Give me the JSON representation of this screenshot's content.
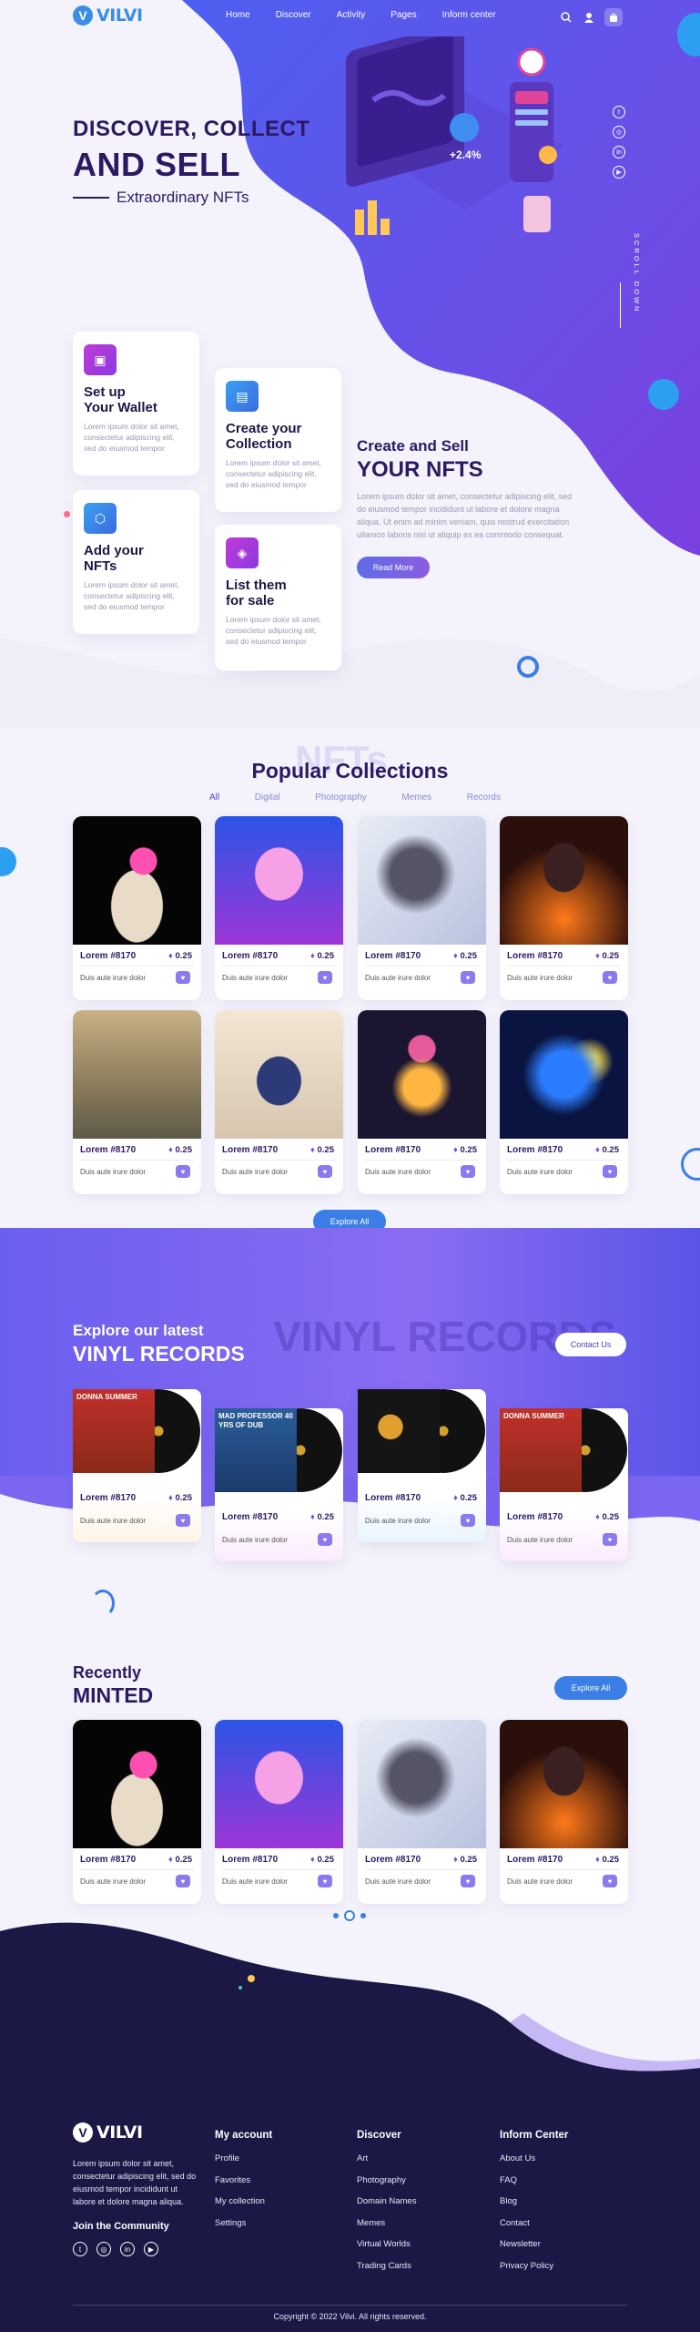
{
  "header": {
    "logo": "VILVI",
    "nav": [
      "Home",
      "Discover",
      "Activity",
      "Pages",
      "Inform center"
    ]
  },
  "hero": {
    "line1": "DISCOVER, COLLECT",
    "line2": "AND SELL",
    "line3": "Extraordinary NFTs",
    "scroll": "SCROLL DOWN",
    "stat": "+2.4%"
  },
  "steps": [
    {
      "title_a": "Set up",
      "title_b": "Your Wallet",
      "text": "Lorem ipsum dolor sit amet, consectetur adipiscing elit, sed do eiusmod tempor"
    },
    {
      "title_a": "Create your",
      "title_b": "Collection",
      "text": "Lorem ipsum dolor sit amet, consectetur adipiscing elit, sed do eiusmod tempor"
    },
    {
      "title_a": "Add your",
      "title_b": "NFTs",
      "text": "Lorem ipsum dolor sit amet, consectetur adipiscing elit, sed do eiusmod tempor"
    },
    {
      "title_a": "List them",
      "title_b": "for sale",
      "text": "Lorem ipsum dolor sit amet, consectetur adipiscing elit, sed do eiusmod tempor"
    }
  ],
  "sell": {
    "title_a": "Create and Sell",
    "title_b": "YOUR NFTS",
    "text": "Lorem ipsum dolor sit amet, consectetur adipiscing elit, sed do eiusmod tempor incididunt ut labore et dolore magna aliqua. Ut enim ad minim veniam, quis nostrud exercitation ullamco laboris nisi ut aliquip ex ea commodo consequat.",
    "button": "Read More"
  },
  "popular": {
    "ghost": "NFTs",
    "title": "Popular Collections",
    "filters": [
      "All",
      "Digital",
      "Photography",
      "Memes",
      "Records"
    ],
    "items": [
      {
        "name": "Lorem #8170",
        "price": "0.25",
        "desc": "Duis aute irure dolor"
      },
      {
        "name": "Lorem #8170",
        "price": "0.25",
        "desc": "Duis aute irure dolor"
      },
      {
        "name": "Lorem #8170",
        "price": "0.25",
        "desc": "Duis aute irure dolor"
      },
      {
        "name": "Lorem #8170",
        "price": "0.25",
        "desc": "Duis aute irure dolor"
      },
      {
        "name": "Lorem #8170",
        "price": "0.25",
        "desc": "Duis aute irure dolor"
      },
      {
        "name": "Lorem #8170",
        "price": "0.25",
        "desc": "Duis aute irure dolor"
      },
      {
        "name": "Lorem #8170",
        "price": "0.25",
        "desc": "Duis aute irure dolor"
      },
      {
        "name": "Lorem #8170",
        "price": "0.25",
        "desc": "Duis aute irure dolor"
      }
    ],
    "button": "Explore All"
  },
  "vinyl": {
    "ghost": "VINYL RECORDS",
    "title_a": "Explore our latest",
    "title_b": "VINYL RECORDS",
    "button": "Contact Us",
    "items": [
      {
        "name": "Lorem #8170",
        "price": "0.25",
        "desc": "Duis aute irure dolor",
        "cover": "DONNA SUMMER"
      },
      {
        "name": "Lorem #8170",
        "price": "0.25",
        "desc": "Duis aute irure dolor",
        "cover": "MAD PROFESSOR 40 YRS OF DUB"
      },
      {
        "name": "Lorem #8170",
        "price": "0.25",
        "desc": "Duis aute irure dolor",
        "cover": ""
      },
      {
        "name": "Lorem #8170",
        "price": "0.25",
        "desc": "Duis aute irure dolor",
        "cover": "DONNA SUMMER"
      }
    ]
  },
  "recent": {
    "title_a": "Recently",
    "title_b": "MINTED",
    "button": "Explore All",
    "items": [
      {
        "name": "Lorem #8170",
        "price": "0.25",
        "desc": "Duis aute irure dolor"
      },
      {
        "name": "Lorem #8170",
        "price": "0.25",
        "desc": "Duis aute irure dolor"
      },
      {
        "name": "Lorem #8170",
        "price": "0.25",
        "desc": "Duis aute irure dolor"
      },
      {
        "name": "Lorem #8170",
        "price": "0.25",
        "desc": "Duis aute irure dolor"
      }
    ]
  },
  "footer": {
    "logo": "VILVI",
    "about": "Lorem ipsum dolor sit amet, consectetur adipiscing elit, sed do eiusmod tempor incididunt ut labore et dolore magna aliqua.",
    "join": "Join the Community",
    "columns": [
      {
        "title": "My account",
        "links": [
          "Profile",
          "Favorites",
          "My collection",
          "Settings"
        ]
      },
      {
        "title": "Discover",
        "links": [
          "Art",
          "Photography",
          "Domain Names",
          "Memes",
          "Virtual Worlds",
          "Trading Cards"
        ]
      },
      {
        "title": "Inform Center",
        "links": [
          "About Us",
          "FAQ",
          "Blog",
          "Contact",
          "Newsletter",
          "Privacy Policy"
        ]
      }
    ],
    "copyright": "Copyright © 2022 Vilvi. All rights reserved."
  }
}
